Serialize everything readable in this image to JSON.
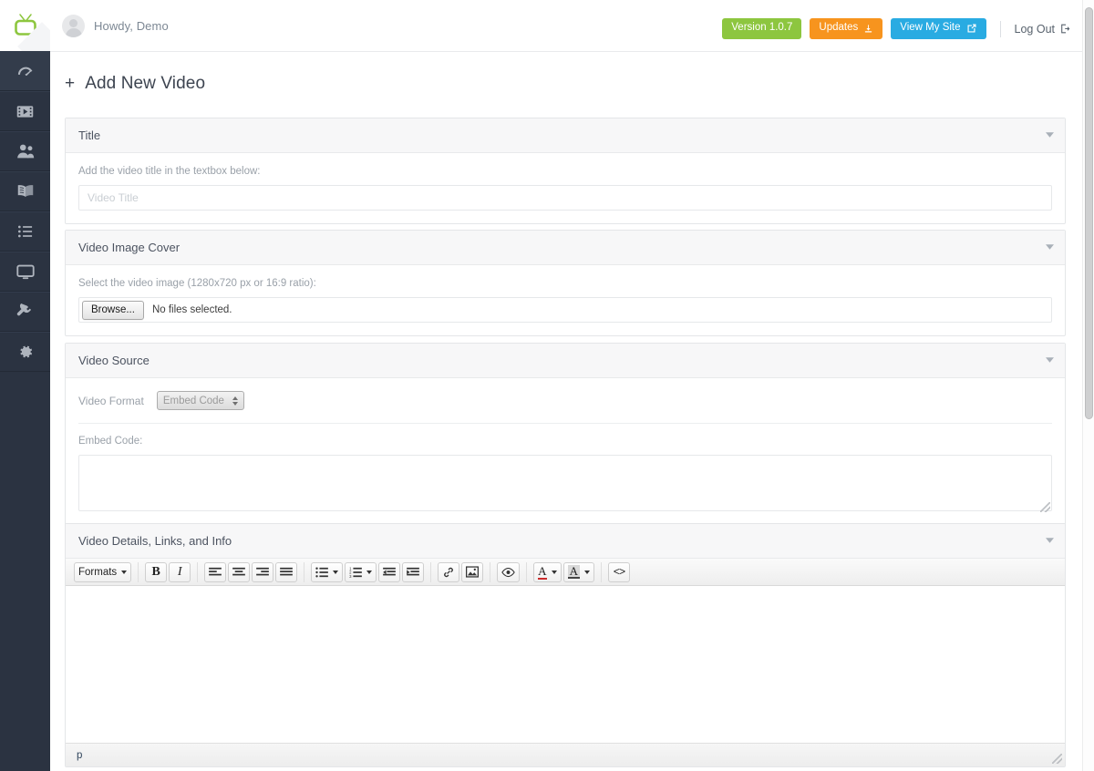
{
  "brand": {
    "logo_icon": "tv-icon",
    "accent_green": "#8dc63f"
  },
  "sidebar": {
    "items": [
      {
        "icon": "dashboard-gauge-icon",
        "name": "dashboard",
        "active": true
      },
      {
        "icon": "video-film-icon",
        "name": "videos",
        "active": false
      },
      {
        "icon": "users-icon",
        "name": "users",
        "active": false
      },
      {
        "icon": "book-icon",
        "name": "library",
        "active": false
      },
      {
        "icon": "list-icon",
        "name": "categories",
        "active": false
      },
      {
        "icon": "monitor-icon",
        "name": "appearance",
        "active": false
      },
      {
        "icon": "plug-icon",
        "name": "plugins",
        "active": false
      },
      {
        "icon": "gear-icon",
        "name": "settings",
        "active": false
      }
    ]
  },
  "topbar": {
    "greeting": "Howdy, Demo",
    "avatar_icon": "user-avatar-icon",
    "version_label": "Version 1.0.7",
    "updates_label": "Updates",
    "updates_icon": "download-icon",
    "view_site_label": "View My Site",
    "view_site_icon": "external-link-icon",
    "logout_label": "Log Out",
    "logout_icon": "logout-icon",
    "colors": {
      "version": "#8dc63f",
      "updates": "#f7941e",
      "view_site": "#29abe2"
    }
  },
  "page": {
    "title": "Add New Video",
    "title_prefix_icon": "plus-icon"
  },
  "panels": {
    "title": {
      "header": "Title",
      "collapse_icon": "chevron-down-icon",
      "helper": "Add the video title in the textbox below:",
      "input_value": "",
      "input_placeholder": "Video Title"
    },
    "cover": {
      "header": "Video Image Cover",
      "collapse_icon": "chevron-down-icon",
      "helper": "Select the video image (1280x720 px or 16:9 ratio):",
      "browse_label": "Browse...",
      "file_status": "No files selected."
    },
    "source": {
      "header": "Video Source",
      "collapse_icon": "chevron-down-icon",
      "format_label": "Video Format",
      "format_value": "Embed Code",
      "format_options": [
        "Embed Code"
      ],
      "embed_label": "Embed Code:",
      "embed_value": ""
    },
    "details": {
      "header": "Video Details, Links, and Info",
      "collapse_icon": "chevron-down-icon",
      "toolbar": {
        "formats_label": "Formats",
        "bold_label": "B",
        "italic_label": "I",
        "align_left": "align-left-icon",
        "align_center": "align-center-icon",
        "align_right": "align-right-icon",
        "align_justify": "align-justify-icon",
        "bullet_list": "bullet-list-icon",
        "numbered_list": "numbered-list-icon",
        "outdent": "outdent-icon",
        "indent": "indent-icon",
        "link": "link-icon",
        "image": "image-icon",
        "preview": "eye-preview-icon",
        "text_color": "A",
        "background_color": "A",
        "source_code": "<>"
      },
      "body_value": "",
      "status_path": "p"
    }
  },
  "scrollbar": {
    "visible": true
  }
}
